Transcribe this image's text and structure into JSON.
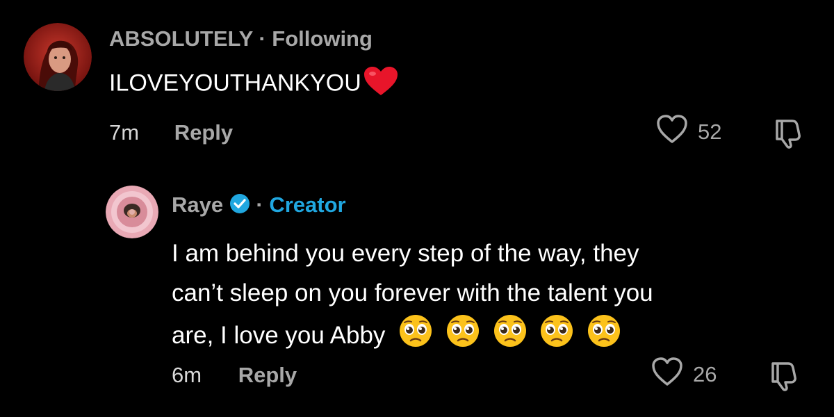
{
  "comments": [
    {
      "username": "ABSOLUTELY",
      "separator": "·",
      "relation": "Following",
      "text": "ILOVEYOUTHANKYOU",
      "emoji": "heart-emoji",
      "time": "7m",
      "reply_label": "Reply",
      "likes": "52"
    },
    {
      "username": "Raye",
      "verified": true,
      "separator": "·",
      "relation": "Creator",
      "text_lines": [
        "I am behind you every step of the way, they",
        "can’t sleep on you forever with the talent you",
        "are, I love you Abby"
      ],
      "emoji": "pleading-face-emoji",
      "emoji_count": 5,
      "time": "6m",
      "reply_label": "Reply",
      "likes": "26"
    }
  ],
  "colors": {
    "background": "#000000",
    "muted": "#a8a8a8",
    "creator_accent": "#20a7e0",
    "verified_badge": "#20a7e0",
    "heart_emoji": "#e8152a"
  }
}
